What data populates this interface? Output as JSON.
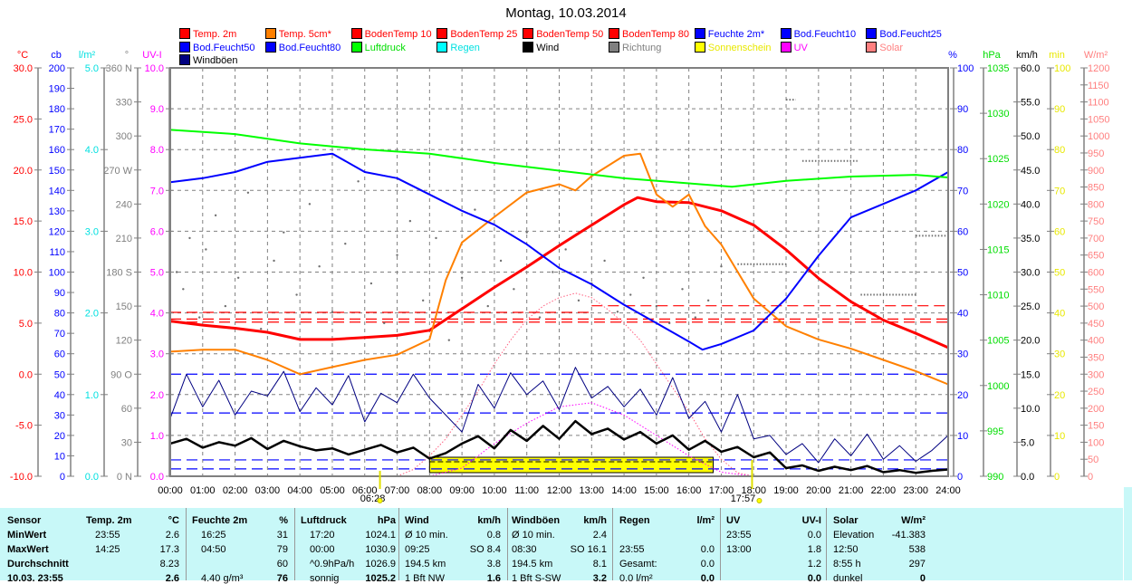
{
  "chart_data": {
    "type": "line",
    "title": "Montag, 10.03.2014",
    "x_ticks": [
      "00:00",
      "01:00",
      "02:00",
      "03:00",
      "04:00",
      "05:00",
      "06:00",
      "07:00",
      "08:00",
      "09:00",
      "10:00",
      "11:00",
      "12:00",
      "13:00",
      "14:00",
      "15:00",
      "16:00",
      "17:00",
      "18:00",
      "19:00",
      "20:00",
      "21:00",
      "22:00",
      "23:00",
      "24:00"
    ],
    "sunrise": "06:28",
    "sunset": "17:57",
    "legend": [
      {
        "label": "Temp. 2m",
        "color": "#ff0000",
        "text": "#ff0000"
      },
      {
        "label": "Temp. 5cm*",
        "color": "#ff8000",
        "text": "#ff0000"
      },
      {
        "label": "BodenTemp 10",
        "color": "#ff0000",
        "text": "#ff0000"
      },
      {
        "label": "BodenTemp 25",
        "color": "#ff0000",
        "text": "#ff0000"
      },
      {
        "label": "BodenTemp 50",
        "color": "#ff0000",
        "text": "#ff0000"
      },
      {
        "label": "BodenTemp 80",
        "color": "#ff0000",
        "text": "#ff0000"
      },
      {
        "label": "Feuchte 2m*",
        "color": "#0000ff",
        "text": "#0000ff"
      },
      {
        "label": "Bod.Feucht10",
        "color": "#0000ff",
        "text": "#0000ff"
      },
      {
        "label": "Bod.Feucht25",
        "color": "#0000ff",
        "text": "#0000ff"
      },
      {
        "label": "Bod.Feucht50",
        "color": "#0000ff",
        "text": "#0000ff"
      },
      {
        "label": "Bod.Feucht80",
        "color": "#0000ff",
        "text": "#0000ff"
      },
      {
        "label": "Luftdruck",
        "color": "#00ff00",
        "text": "#00dd00"
      },
      {
        "label": "Regen",
        "color": "#00ffff",
        "text": "#00e0e0"
      },
      {
        "label": "Wind",
        "color": "#000000",
        "text": "#000000"
      },
      {
        "label": "Richtung",
        "color": "#808080",
        "text": "#808080"
      },
      {
        "label": "Sonnenschein",
        "color": "#ffff00",
        "text": "#e8e800"
      },
      {
        "label": "UV",
        "color": "#ff00ff",
        "text": "#ff00ff"
      },
      {
        "label": "Solar",
        "color": "#ff8080",
        "text": "#ff8080"
      },
      {
        "label": "Windböen",
        "color": "#000080",
        "text": "#000000"
      }
    ],
    "axes_left": [
      {
        "unit": "°C",
        "color": "#ff0000",
        "range": [
          -10,
          30
        ],
        "ticks": [
          "30.0",
          "25.0",
          "20.0",
          "15.0",
          "10.0",
          "5.0",
          "0.0",
          "-5.0",
          "-10.0"
        ]
      },
      {
        "unit": "cb",
        "color": "#0000ff",
        "range": [
          0,
          200
        ],
        "ticks": [
          "200",
          "190",
          "180",
          "170",
          "160",
          "150",
          "140",
          "130",
          "120",
          "110",
          "100",
          "90",
          "80",
          "70",
          "60",
          "50",
          "40",
          "30",
          "20",
          "10",
          "0"
        ]
      },
      {
        "unit": "l/m²",
        "color": "#00e0e0",
        "range": [
          0,
          5
        ],
        "ticks": [
          "5.0",
          "4.0",
          "3.0",
          "2.0",
          "1.0",
          "0.0"
        ]
      },
      {
        "unit": "°",
        "color": "#808080",
        "range": [
          0,
          360
        ],
        "ticks": [
          "360 N",
          "330",
          "300",
          "270 W",
          "240",
          "210",
          "180 S",
          "150",
          "120",
          "90  O",
          "60",
          "30",
          "0   N"
        ]
      },
      {
        "unit": "UV-I",
        "color": "#ff00ff",
        "range": [
          0,
          10
        ],
        "ticks": [
          "10.0",
          "9.0",
          "8.0",
          "7.0",
          "6.0",
          "5.0",
          "4.0",
          "3.0",
          "2.0",
          "1.0",
          "0.0"
        ]
      }
    ],
    "axes_right": [
      {
        "unit": "%",
        "color": "#0000ff",
        "range": [
          0,
          100
        ],
        "ticks": [
          "100",
          "90",
          "80",
          "70",
          "60",
          "50",
          "40",
          "30",
          "20",
          "10",
          "0"
        ]
      },
      {
        "unit": "hPa",
        "color": "#00dd00",
        "range": [
          990,
          1038.1
        ],
        "ticks": [
          "1035",
          "1030",
          "1025",
          "1020",
          "1015",
          "1010",
          "1005",
          "1000",
          "995",
          "990"
        ]
      },
      {
        "unit": "km/h",
        "color": "#000000",
        "range": [
          0,
          60
        ],
        "ticks": [
          "60.0",
          "55.0",
          "50.0",
          "45.0",
          "40.0",
          "35.0",
          "30.0",
          "25.0",
          "20.0",
          "15.0",
          "10.0",
          "5.0",
          "0.0"
        ]
      },
      {
        "unit": "min",
        "color": "#e8e800",
        "range": [
          0,
          100
        ],
        "ticks": [
          "100",
          "90",
          "80",
          "70",
          "60",
          "50",
          "40",
          "30",
          "20",
          "10",
          "0"
        ]
      },
      {
        "unit": "W/m²",
        "color": "#ff8080",
        "range": [
          0,
          1200
        ],
        "ticks": [
          "1200",
          "1150",
          "1100",
          "1050",
          "1000",
          "950",
          "900",
          "850",
          "800",
          "750",
          "700",
          "650",
          "600",
          "550",
          "500",
          "450",
          "400",
          "350",
          "300",
          "250",
          "200",
          "150",
          "100",
          "50",
          "0"
        ]
      }
    ],
    "series": [
      {
        "name": "Temp. 2m",
        "axis": "°C",
        "color": "#ff0000",
        "width": 3,
        "x": [
          0,
          1,
          2,
          3,
          4,
          5,
          6,
          7,
          8,
          9,
          10,
          11,
          12,
          13,
          14,
          14.42,
          15,
          16,
          17,
          18,
          19,
          20,
          21,
          22,
          23,
          24
        ],
        "y": [
          5.2,
          4.8,
          4.5,
          4.1,
          3.4,
          3.4,
          3.6,
          3.8,
          4.3,
          6.4,
          8.5,
          10.5,
          12.6,
          14.6,
          16.6,
          17.3,
          16.9,
          16.8,
          16.0,
          14.6,
          12.2,
          9.4,
          7.1,
          5.3,
          4.0,
          2.6
        ]
      },
      {
        "name": "Temp. 5cm*",
        "axis": "°C",
        "color": "#ff8000",
        "width": 2,
        "x": [
          0,
          1,
          2,
          3,
          4,
          5,
          6,
          7,
          8,
          8.5,
          9,
          10,
          11,
          12,
          12.5,
          13,
          14,
          14.5,
          15,
          15.5,
          16,
          16.5,
          17,
          18,
          19,
          20,
          21,
          22,
          23,
          24
        ],
        "y": [
          2.2,
          2.4,
          2.4,
          1.4,
          0.0,
          0.7,
          1.4,
          1.9,
          3.4,
          9.2,
          12.9,
          15.4,
          17.8,
          18.6,
          18.0,
          19.4,
          21.4,
          21.6,
          17.6,
          16.4,
          17.6,
          14.5,
          12.7,
          7.4,
          4.7,
          3.4,
          2.5,
          1.4,
          0.3,
          -1.0
        ]
      },
      {
        "name": "Feuchte 2m*",
        "axis": "%",
        "color": "#0000ff",
        "width": 2,
        "x": [
          0,
          1,
          2,
          3,
          4,
          5,
          6,
          7,
          8,
          9,
          10,
          11,
          12,
          13,
          14,
          15,
          16,
          16.42,
          17,
          18,
          19,
          20,
          21,
          22,
          23,
          24
        ],
        "y": [
          72,
          73,
          74.5,
          77,
          78,
          79,
          74.5,
          73,
          69,
          65,
          61.6,
          56.8,
          51,
          47,
          42,
          37.5,
          33,
          31,
          32.4,
          35.7,
          43.5,
          54,
          63.4,
          66.7,
          70,
          74.5
        ]
      },
      {
        "name": "Luftdruck",
        "axis": "hPa",
        "color": "#00ff00",
        "width": 2,
        "x": [
          0,
          2,
          4,
          6,
          8,
          10,
          12,
          14,
          16,
          17.33,
          19,
          21,
          23,
          24
        ],
        "y": [
          1030.8,
          1030.3,
          1029.2,
          1028.5,
          1028.0,
          1026.9,
          1026.0,
          1025.1,
          1024.5,
          1024.1,
          1024.8,
          1025.3,
          1025.5,
          1025.2
        ]
      },
      {
        "name": "Solar",
        "axis": "W/m²",
        "color": "#ff6080",
        "width": 1,
        "dotted": true,
        "x": [
          7,
          7.5,
          8,
          8.5,
          9,
          9.5,
          10,
          10.5,
          11,
          11.5,
          12,
          12.5,
          13,
          13.5,
          14,
          14.5,
          15,
          15.5,
          16,
          16.5,
          17,
          17.5,
          18
        ],
        "y": [
          0,
          20,
          60,
          110,
          180,
          250,
          330,
          400,
          460,
          500,
          525,
          538,
          525,
          490,
          450,
          400,
          330,
          260,
          190,
          110,
          50,
          10,
          0
        ]
      },
      {
        "name": "UV",
        "axis": "UV-I",
        "color": "#ff00ff",
        "width": 1,
        "dotted": true,
        "x": [
          8,
          9,
          10,
          11,
          12,
          13,
          14,
          15,
          16,
          17,
          18
        ],
        "y": [
          0,
          0.2,
          0.8,
          1.3,
          1.7,
          1.8,
          1.5,
          1.0,
          0.5,
          0.1,
          0
        ]
      },
      {
        "name": "Windböen",
        "axis": "km/h",
        "color": "#000080",
        "width": 1,
        "step": 0.5,
        "y": [
          8.5,
          15.0,
          10.2,
          14.1,
          9.0,
          12.5,
          11.8,
          15.4,
          9.5,
          13.0,
          10.5,
          14.8,
          8.0,
          12.2,
          10.8,
          15.0,
          11.5,
          9.0,
          6.5,
          13.5,
          10.0,
          15.2,
          12.0,
          14.0,
          9.8,
          16.0,
          11.5,
          13.2,
          10.2,
          12.8,
          9.0,
          14.5,
          8.5,
          11.0,
          6.5,
          12.0,
          5.5,
          6.0,
          3.2,
          4.8,
          2.0,
          5.5,
          3.0,
          6.2,
          2.5,
          4.5,
          2.2,
          3.8,
          6.0
        ]
      },
      {
        "name": "Wind",
        "axis": "km/h",
        "color": "#000000",
        "width": 2.5,
        "step": 0.5,
        "y": [
          4.8,
          5.5,
          4.2,
          5.0,
          4.5,
          5.6,
          4.0,
          5.2,
          4.4,
          3.8,
          4.1,
          3.2,
          3.9,
          4.6,
          3.5,
          4.2,
          2.6,
          3.4,
          4.8,
          5.9,
          4.1,
          6.8,
          5.2,
          7.4,
          5.5,
          8.1,
          6.2,
          7.0,
          5.4,
          6.5,
          4.8,
          6.0,
          3.9,
          5.2,
          3.6,
          4.3,
          2.8,
          3.5,
          1.2,
          1.6,
          0.8,
          1.4,
          0.9,
          1.5,
          0.6,
          0.9,
          0.5,
          0.8,
          1.0
        ]
      }
    ],
    "soil_lines": [
      {
        "name": "BodenTemp 10",
        "axis": "°C",
        "color": "#ff0000",
        "x": [
          0,
          13
        ],
        "y": 6.05
      },
      {
        "name": "BodenTemp 10",
        "axis": "°C",
        "color": "#ff0000",
        "x": [
          13,
          24
        ],
        "y": 6.7
      },
      {
        "name": "BodenTemp 25",
        "axis": "°C",
        "color": "#ff0000",
        "x": [
          0,
          24
        ],
        "y": 5.4
      },
      {
        "name": "BodenTemp 50",
        "axis": "°C",
        "color": "#ff0000",
        "x": [
          0,
          24
        ],
        "y": 5.1
      },
      {
        "name": "Bod.Feucht10",
        "axis": "%",
        "color": "#0000ff",
        "x": [
          0,
          24
        ],
        "y": 25
      },
      {
        "name": "Bod.Feucht25",
        "axis": "%",
        "color": "#0000ff",
        "x": [
          0,
          24
        ],
        "y": 15.5
      },
      {
        "name": "Bod.Feucht50",
        "axis": "%",
        "color": "#0000ff",
        "x": [
          0,
          24
        ],
        "y": 4
      },
      {
        "name": "Bod.Feucht80",
        "axis": "%",
        "color": "#0000ff",
        "x": [
          0,
          24
        ],
        "y": 1.8
      }
    ],
    "sunshine_interval": [
      8.0,
      16.75
    ],
    "direction": {
      "x": [
        0.2,
        0.4,
        0.6,
        0.9,
        1.1,
        1.4,
        1.7,
        2.1,
        2.4,
        2.8,
        3.2,
        3.5,
        3.9,
        4.3,
        4.6,
        5.0,
        5.4,
        5.8,
        6.2,
        6.6,
        7.0,
        7.4,
        7.8,
        8.2,
        8.6,
        9.0,
        9.4,
        9.8,
        10.2,
        10.6,
        11.0,
        11.4,
        11.8,
        12.2,
        12.6,
        13.0,
        13.4,
        13.8,
        14.2,
        14.6,
        15.0,
        15.4,
        15.8,
        16.2,
        16.6,
        17.0
      ],
      "y": [
        180,
        165,
        210,
        140,
        200,
        230,
        150,
        175,
        250,
        130,
        190,
        215,
        160,
        240,
        185,
        145,
        205,
        260,
        170,
        135,
        195,
        225,
        155,
        210,
        120,
        175,
        235,
        150,
        190,
        165,
        215,
        140,
        180,
        200,
        155,
        170,
        190,
        145,
        160,
        175,
        150,
        135,
        165,
        140,
        155,
        185
      ]
    },
    "direction_segments": [
      {
        "x": [
          17.5,
          19.0
        ],
        "y": 187
      },
      {
        "x": [
          19.0,
          19.3
        ],
        "y": 332
      },
      {
        "x": [
          19.5,
          21.2
        ],
        "y": 278
      },
      {
        "x": [
          21.3,
          23.0
        ],
        "y": 160
      },
      {
        "x": [
          23.0,
          24.0
        ],
        "y": 212
      }
    ]
  },
  "stats": {
    "headers": [
      {
        "label": "Sensor",
        "unit": ""
      },
      {
        "label": "Temp. 2m",
        "unit": "°C"
      },
      {
        "label": "Feuchte 2m",
        "unit": "%"
      },
      {
        "label": "Luftdruck",
        "unit": "hPa"
      },
      {
        "label": "Wind",
        "unit": "km/h"
      },
      {
        "label": "Windböen",
        "unit": "km/h"
      },
      {
        "label": "Regen",
        "unit": "l/m²"
      },
      {
        "label": "UV",
        "unit": "UV-I"
      },
      {
        "label": "Solar",
        "unit": "W/m²"
      }
    ],
    "rows": [
      {
        "label": "MinWert",
        "cells": [
          [
            "23:55",
            "2.6"
          ],
          [
            "16:25",
            "31"
          ],
          [
            "17:20",
            "1024.1"
          ],
          [
            "Ø 10 min.",
            "0.8"
          ],
          [
            "Ø 10 min.",
            "2.4"
          ],
          [
            "",
            ""
          ],
          [
            "23:55",
            "0.0"
          ],
          [
            "Elevation",
            "-41.383"
          ]
        ]
      },
      {
        "label": "MaxWert",
        "cells": [
          [
            "14:25",
            "17.3"
          ],
          [
            "04:50",
            "79"
          ],
          [
            "00:00",
            "1030.9"
          ],
          [
            "09:25",
            "SO 8.4"
          ],
          [
            "08:30",
            "SO 16.1"
          ],
          [
            "23:55",
            "0.0"
          ],
          [
            "13:00",
            "1.8"
          ],
          [
            "12:50",
            "538"
          ]
        ]
      },
      {
        "label": "Durchschnitt",
        "cells": [
          [
            "",
            "8.23"
          ],
          [
            "",
            "60"
          ],
          [
            "^0.9hPa/h",
            "1026.9"
          ],
          [
            "194.5 km",
            "3.8"
          ],
          [
            "194.5 km",
            "8.1"
          ],
          [
            "Gesamt:",
            "0.0"
          ],
          [
            "",
            "1.2"
          ],
          [
            "8:55 h",
            "297"
          ]
        ]
      },
      {
        "label": "10.03. 23:55",
        "cells": [
          [
            "",
            "2.6"
          ],
          [
            "4.40 g/m³",
            "76"
          ],
          [
            "sonnig",
            "1025.2"
          ],
          [
            "1 Bft NW",
            "1.6"
          ],
          [
            "1 Bft S-SW",
            "3.2"
          ],
          [
            "0.0 l/m²",
            "0.0"
          ],
          [
            "",
            "0.0"
          ],
          [
            "dunkel",
            "0"
          ]
        ]
      }
    ]
  }
}
